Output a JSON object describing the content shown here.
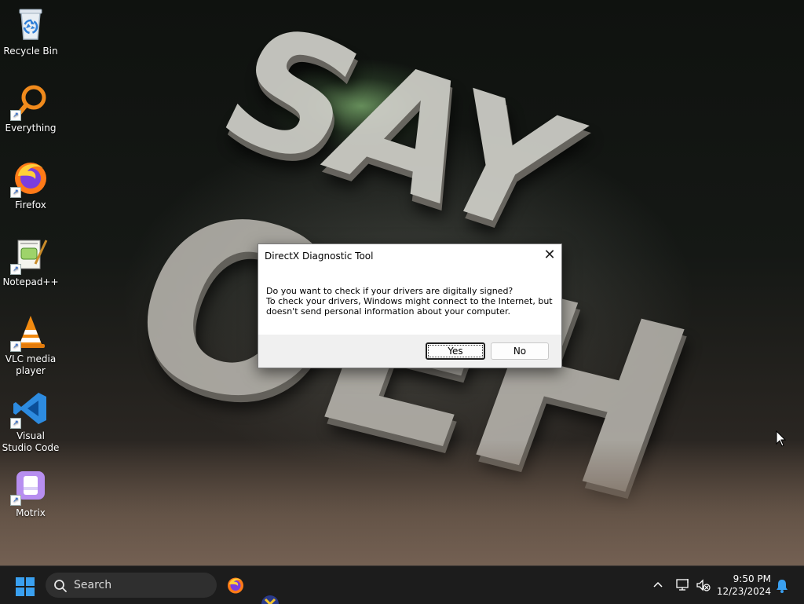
{
  "wallpaper": {
    "line1": "SAY",
    "line2": "OEH"
  },
  "desktop": {
    "icons": [
      {
        "label": "Recycle Bin",
        "icon": "recycle-bin-icon"
      },
      {
        "label": "Everything",
        "icon": "everything-icon"
      },
      {
        "label": "Firefox",
        "icon": "firefox-icon"
      },
      {
        "label": "Notepad++",
        "icon": "notepad-plus-plus-icon"
      },
      {
        "label": "VLC media player",
        "icon": "vlc-icon"
      },
      {
        "label": "Visual Studio Code",
        "icon": "vscode-icon"
      },
      {
        "label": "Motrix",
        "icon": "motrix-icon"
      }
    ]
  },
  "dialog": {
    "title": "DirectX Diagnostic Tool",
    "close_glyph": "✕",
    "message_lines": [
      "Do you want to check if your drivers are digitally signed?",
      "To check your drivers, Windows might connect to the Internet, but",
      "doesn't send personal information about your computer."
    ],
    "yes_label": "Yes",
    "no_label": "No"
  },
  "taskbar": {
    "search_placeholder": "Search",
    "time": "9:50 PM",
    "date": "12/23/2024"
  },
  "colors": {
    "taskbar_bg": "#1c1c1c",
    "dialog_footer_bg": "#f0f0f0",
    "start_blue": "#3aa0f0",
    "vscode_blue": "#2d8be0",
    "everything_orange": "#f08a1c"
  }
}
